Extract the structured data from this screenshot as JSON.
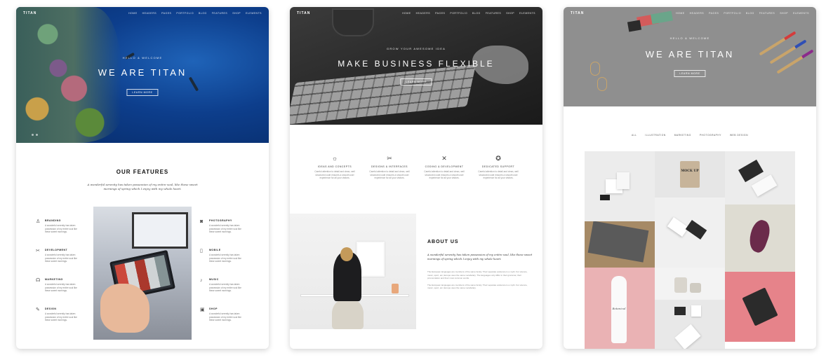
{
  "card1": {
    "logo": "TITAN",
    "nav": [
      "Home",
      "Headers",
      "Pages",
      "Portfolio",
      "Blog",
      "Features",
      "Shop",
      "Elements"
    ],
    "hero_kicker": "Hello & welcome",
    "hero_headline": "WE ARE TITAN",
    "hero_button": "Learn more",
    "features_title": "OUR FEATURES",
    "features_lead": "A wonderful serenity has taken possession of my entire soul, like these sweet mornings of spring which I enjoy with my whole heart.",
    "features_left": [
      {
        "icon": "lightbulb-icon",
        "glyph": "♙",
        "title": "Branding",
        "desc": "A wonderful serenity has taken possession of my entire soul like these sweet mornings."
      },
      {
        "icon": "tools-icon",
        "glyph": "✂",
        "title": "Development",
        "desc": "A wonderful serenity has taken possession of my entire soul like these sweet mornings."
      },
      {
        "icon": "megaphone-icon",
        "glyph": "☊",
        "title": "Marketing",
        "desc": "A wonderful serenity has taken possession of my entire soul like these sweet mornings."
      },
      {
        "icon": "pen-icon",
        "glyph": "✎",
        "title": "Design",
        "desc": "A wonderful serenity has taken possession of my entire soul like these sweet mornings."
      }
    ],
    "features_right": [
      {
        "icon": "camera-icon",
        "glyph": "◙",
        "title": "Photography",
        "desc": "A wonderful serenity has taken possession of my entire soul like these sweet mornings."
      },
      {
        "icon": "mobile-icon",
        "glyph": "▯",
        "title": "Mobile",
        "desc": "A wonderful serenity has taken possession of my entire soul like these sweet mornings."
      },
      {
        "icon": "music-icon",
        "glyph": "♪",
        "title": "Music",
        "desc": "A wonderful serenity has taken possession of my entire soul like these sweet mornings."
      },
      {
        "icon": "shop-icon",
        "glyph": "▣",
        "title": "Shop",
        "desc": "A wonderful serenity has taken possession of my entire soul like these sweet mornings."
      }
    ]
  },
  "card2": {
    "logo": "TITAN",
    "nav": [
      "Home",
      "Headers",
      "Pages",
      "Portfolio",
      "Blog",
      "Features",
      "Shop",
      "Elements"
    ],
    "hero_kicker": "Grow your awesome idea",
    "hero_headline": "MAKE BUSINESS FLEXIBLE",
    "hero_button": "Learn more",
    "services": [
      {
        "icon": "bulb-icon",
        "glyph": "☼",
        "title": "Ideas and concepts",
        "desc": "Careful attention to detail and clean, well structured code ensures a smooth user experience for all your visitors."
      },
      {
        "icon": "tools-icon",
        "glyph": "✂",
        "title": "Designs & interfaces",
        "desc": "Careful attention to detail and clean, well structured code ensures a smooth user experience for all your visitors."
      },
      {
        "icon": "wrench-icon",
        "glyph": "✕",
        "title": "Coding & development",
        "desc": "Careful attention to detail and clean, well structured code ensures a smooth user experience for all your visitors."
      },
      {
        "icon": "lifebuoy-icon",
        "glyph": "✪",
        "title": "Dedicated support",
        "desc": "Careful attention to detail and clean, well structured code ensures a smooth user experience for all your visitors."
      }
    ],
    "about_title": "ABOUT US",
    "about_quote": "A wonderful serenity has taken possession of my entire soul, like these sweet mornings of spring which I enjoy with my whole heart.",
    "about_p1": "The European languages are members of the same family. Their separate existence is a myth. For science, music, sport, etc, Europe uses the same vocabulary. The languages only differ in their grammar, their pronunciation and their most common words.",
    "about_p2": "The European languages are members of the same family. Their separate existence is a myth. For science, music, sport, etc, Europe uses the same vocabulary."
  },
  "card3": {
    "logo": "TITAN",
    "nav": [
      "Home",
      "Headers",
      "Pages",
      "Portfolio",
      "Blog",
      "Features",
      "Shop",
      "Elements"
    ],
    "hero_kicker": "Hello & welcome",
    "hero_headline": "WE ARE TITAN",
    "hero_button": "Learn more",
    "filters": [
      "All",
      "Illustration",
      "Marketing",
      "Photography",
      "Web Design"
    ],
    "mockup_bag_text": "MOCK UP",
    "bottle_text": "Botanical"
  },
  "colors": {
    "reef_blue": "#0d3e8c",
    "dark_hero": "#262626",
    "grey_hero": "#8f8f8f",
    "pink_tile": "#eab2b4"
  }
}
